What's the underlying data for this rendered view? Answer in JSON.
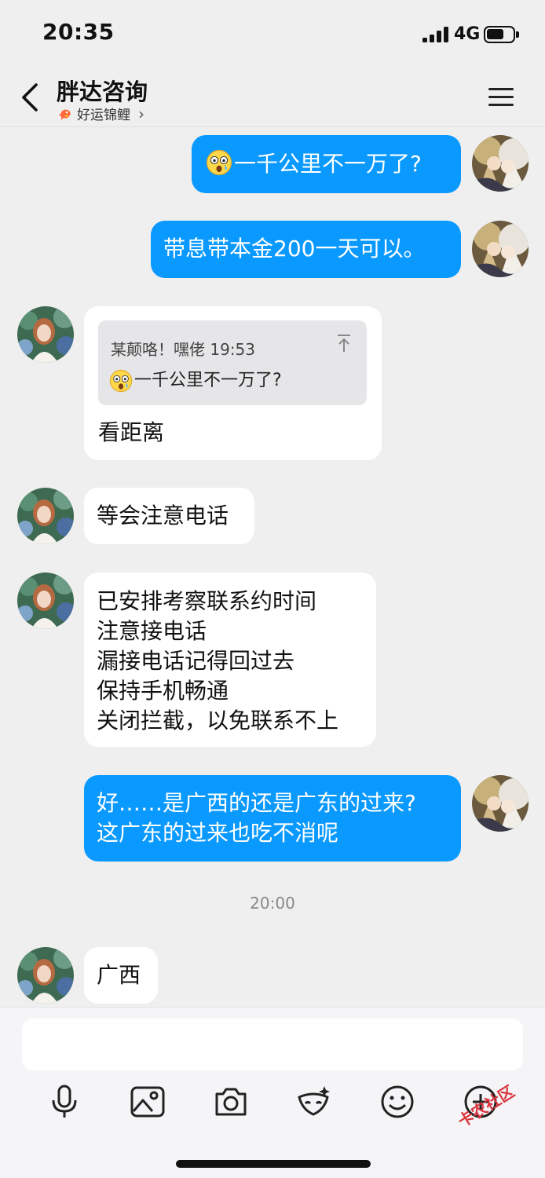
{
  "status": {
    "time": "20:35",
    "network": "4G"
  },
  "header": {
    "title": "胖达咨询",
    "subtitle": "好运锦鲤"
  },
  "messages": [
    {
      "text": "一千公里不一万了?"
    },
    {
      "text": "带息带本金200一天可以。"
    },
    {
      "quote_header": "某颠咯！嘿佬 19:53",
      "quote_text": "一千公里不一万了?",
      "text": "看距离"
    },
    {
      "text": "等会注意电话"
    },
    {
      "lines": [
        "已安排考察联系约时间",
        "注意接电话",
        "漏接电话记得回过去",
        "保持手机畅通",
        "关闭拦截，以免联系不上"
      ]
    },
    {
      "lines": [
        "好……是广西的还是广东的过来?",
        "这广东的过来也吃不消呢"
      ]
    },
    {
      "text": "广西"
    }
  ],
  "timestamp": "20:00",
  "watermark": "卡农社区",
  "colors": {
    "outgoing_bubble": "#0a99ff",
    "incoming_bubble": "#ffffff",
    "background": "#efeff0"
  }
}
